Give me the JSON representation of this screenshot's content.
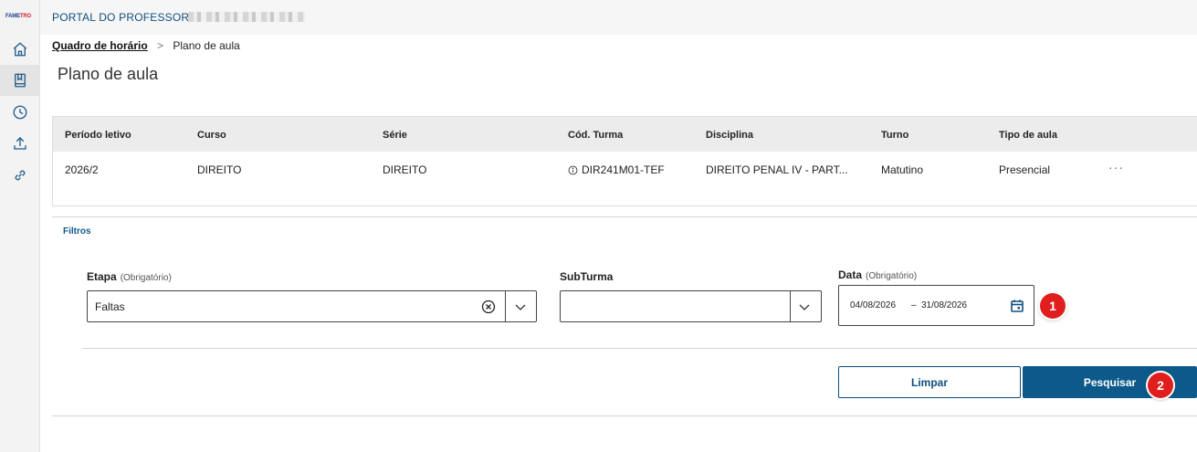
{
  "logo": {
    "text_a": "FAME",
    "text_b": "TRO"
  },
  "sidebar": {
    "items": [
      {
        "icon": "home-icon",
        "active": false
      },
      {
        "icon": "book-icon",
        "active": true
      },
      {
        "icon": "clock-icon",
        "active": false
      },
      {
        "icon": "upload-icon",
        "active": false
      },
      {
        "icon": "link-icon",
        "active": false
      }
    ]
  },
  "topbar": {
    "portal": "PORTAL DO PROFESSOR > L"
  },
  "breadcrumb": {
    "link": "Quadro de horário",
    "separator": ">",
    "current": "Plano de aula"
  },
  "page": {
    "title": "Plano de aula"
  },
  "info_table": {
    "headers": [
      "Período letivo",
      "Curso",
      "Série",
      "Cód. Turma",
      "Disciplina",
      "Turno",
      "Tipo de aula"
    ],
    "row": [
      "2026/2",
      "DIREITO",
      "DIREITO",
      "DIR241M01-TEF",
      "DIREITO PENAL IV - PART...",
      "Matutino",
      "Presencial"
    ],
    "more": "···"
  },
  "filters": {
    "title": "Filtros",
    "etapa": {
      "label": "Etapa",
      "required": "(Obrigatório)",
      "value": "Faltas"
    },
    "subturma": {
      "label": "SubTurma",
      "value": ""
    },
    "data": {
      "label": "Data",
      "required": "(Obrigatório)",
      "start": "04/08/2026",
      "dash": "–",
      "end": "31/08/2026"
    }
  },
  "buttons": {
    "clear": "Limpar",
    "search": "Pesquisar"
  },
  "markers": [
    "1",
    "2"
  ],
  "colors": {
    "primary": "#0d5a8a",
    "marker": "#e01e1e",
    "link": "#0f4e7e"
  }
}
